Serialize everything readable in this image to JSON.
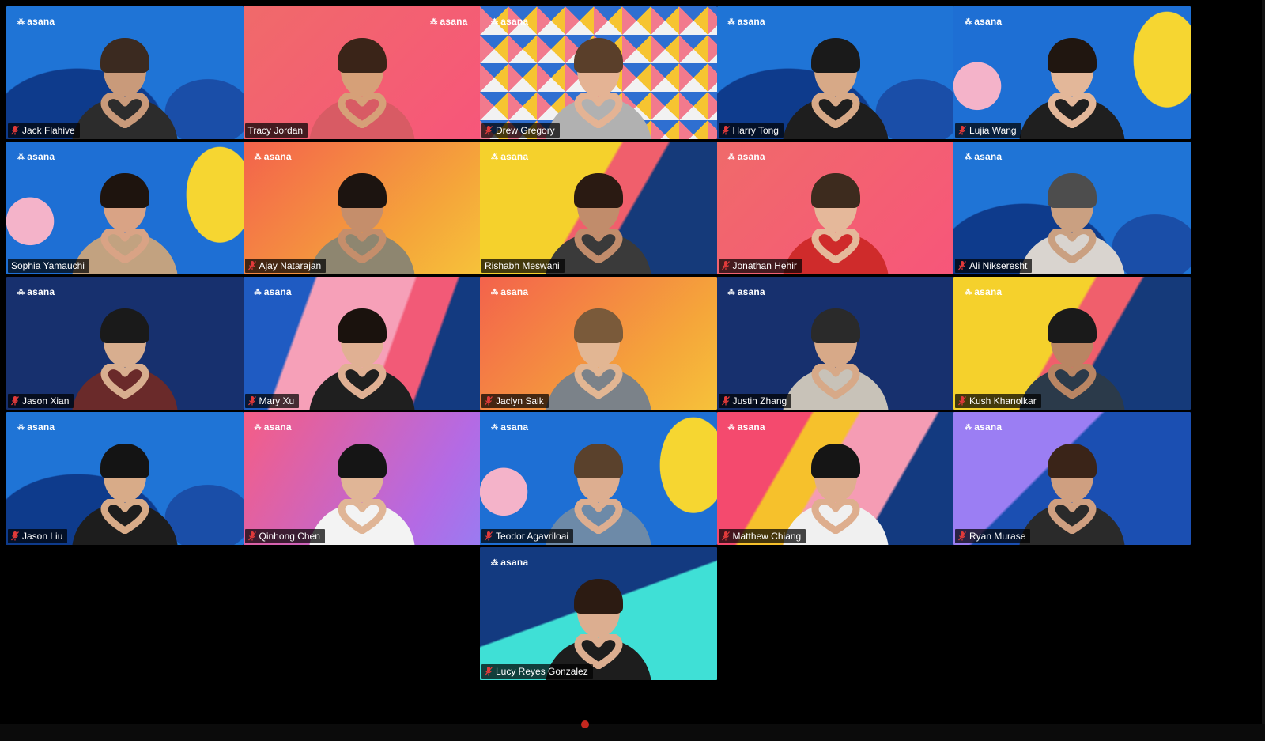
{
  "app": {
    "brand": "asana"
  },
  "participants": [
    {
      "name": "Jack Flahive",
      "muted": true,
      "bg": "blue-blob",
      "skin": "#c99a7a",
      "hair": "#3b2a20",
      "shirt": "#2c2c2c"
    },
    {
      "name": "Tracy Jordan",
      "muted": false,
      "active": true,
      "bg": "coral",
      "skin": "#d6a078",
      "hair": "#3a2418",
      "shirt": "#d85b64"
    },
    {
      "name": "Drew Gregory",
      "muted": true,
      "bg": "triangles",
      "skin": "#e4b394",
      "hair": "#5a3f2a",
      "shirt": "#b1b1b1"
    },
    {
      "name": "Harry Tong",
      "muted": true,
      "bg": "blue-blob",
      "skin": "#d7a987",
      "hair": "#1a1a1a",
      "shirt": "#1e1e1e"
    },
    {
      "name": "Lujia Wang",
      "muted": true,
      "bg": "blue-yellow",
      "skin": "#e3b799",
      "hair": "#201610",
      "shirt": "#1f1f1f"
    },
    {
      "name": "Sophia Yamauchi",
      "muted": false,
      "bg": "blue-yellow",
      "skin": "#d9a385",
      "hair": "#1e140e",
      "shirt": "#c2a280"
    },
    {
      "name": "Ajay Natarajan",
      "muted": true,
      "bg": "orange",
      "skin": "#c58e6b",
      "hair": "#1c1410",
      "shirt": "#8e8670"
    },
    {
      "name": "Rishabh Meswani",
      "muted": false,
      "bg": "yellow-navy",
      "skin": "#c18c6b",
      "hair": "#2a1a12",
      "shirt": "#3a3a3a"
    },
    {
      "name": "Jonathan Hehir",
      "muted": true,
      "bg": "coral",
      "skin": "#e5b89a",
      "hair": "#3d2b1e",
      "shirt": "#cf2b2b"
    },
    {
      "name": "Ali Nikseresht",
      "muted": true,
      "bg": "blue-blob",
      "skin": "#caa081",
      "hair": "#4d4d4d",
      "shirt": "#d9d4cf"
    },
    {
      "name": "Jason Xian",
      "muted": true,
      "bg": "navy-icons",
      "skin": "#d8ae8f",
      "hair": "#1a1a1a",
      "shirt": "#6a2a2a"
    },
    {
      "name": "Mary Xu",
      "muted": true,
      "bg": "navy-pink",
      "skin": "#e0b093",
      "hair": "#1a120d",
      "shirt": "#1f1f1f"
    },
    {
      "name": "Jaclyn Saik",
      "muted": true,
      "bg": "orange",
      "skin": "#e2b693",
      "hair": "#7a5a3a",
      "shirt": "#7b8289"
    },
    {
      "name": "Justin Zhang",
      "muted": true,
      "bg": "navy-icons",
      "skin": "#d7a988",
      "hair": "#2a2a2a",
      "shirt": "#c8c2b8"
    },
    {
      "name": "Kush Khanolkar",
      "muted": true,
      "bg": "yellow-navy",
      "skin": "#b98563",
      "hair": "#1a1a1a",
      "shirt": "#2b3a4a"
    },
    {
      "name": "Jason Liu",
      "muted": true,
      "bg": "blue-blob",
      "skin": "#d8ab88",
      "hair": "#141414",
      "shirt": "#1d1d1d"
    },
    {
      "name": "Qinhong Chen",
      "muted": true,
      "bg": "pink-purple",
      "skin": "#e0b596",
      "hair": "#151515",
      "shirt": "#f3f3f3"
    },
    {
      "name": "Teodor Agavriloai",
      "muted": true,
      "bg": "blue-yellow",
      "skin": "#ddae90",
      "hair": "#5a412c",
      "shirt": "#6d8aa8"
    },
    {
      "name": "Matthew Chiang",
      "muted": true,
      "bg": "coral-pink",
      "skin": "#deae8e",
      "hair": "#151515",
      "shirt": "#f0f0f0"
    },
    {
      "name": "Ryan Murase",
      "muted": true,
      "bg": "purple-navy",
      "skin": "#cf9f80",
      "hair": "#3a2418",
      "shirt": "#2a2a2a"
    },
    {
      "name": "Lucy Reyes Gonzalez",
      "muted": true,
      "bg": "teal-navy",
      "skin": "#dcae90",
      "hair": "#2c1b12",
      "shirt": "#1d1d1d"
    }
  ]
}
